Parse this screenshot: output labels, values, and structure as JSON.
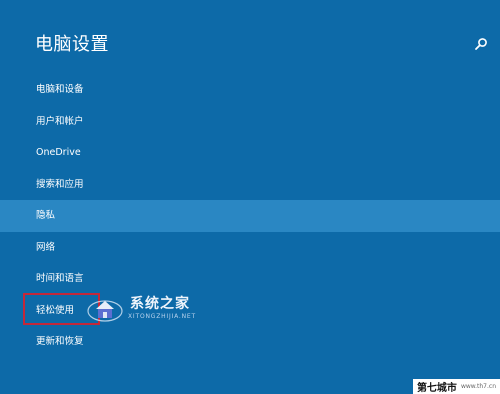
{
  "header": {
    "title": "电脑设置",
    "search_icon": "search-icon"
  },
  "menu": {
    "items": [
      {
        "label": "电脑和设备"
      },
      {
        "label": "用户和帐户"
      },
      {
        "label": "OneDrive"
      },
      {
        "label": "搜索和应用"
      },
      {
        "label": "隐私",
        "selected": true
      },
      {
        "label": "网络"
      },
      {
        "label": "时间和语言"
      },
      {
        "label": "轻松使用",
        "highlighted": true
      },
      {
        "label": "更新和恢复"
      }
    ]
  },
  "watermark": {
    "title": "系统之家",
    "subtitle": "XITONGZHIJIA.NET"
  },
  "footer_watermark": {
    "cn": "第七城市",
    "en": "www.th7.cn"
  },
  "colors": {
    "background": "#0d6aa8",
    "selected_row": "#2a87c3",
    "highlight_box": "#c4283a"
  }
}
